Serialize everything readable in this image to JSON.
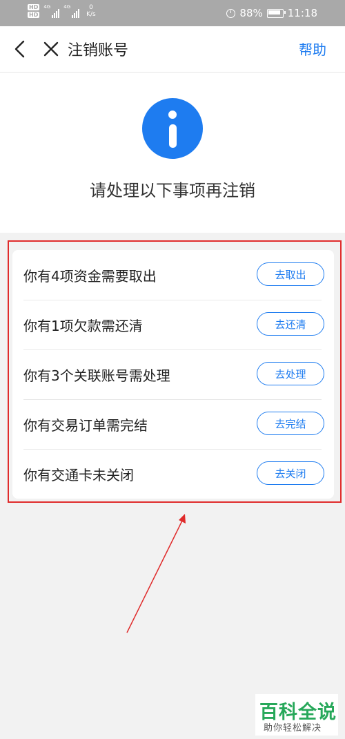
{
  "status_bar": {
    "hd_top": "HD",
    "hd_bottom": "HD",
    "net1": "4G",
    "net2": "4G",
    "speed_value": "0",
    "speed_unit": "K/s",
    "battery": "88%",
    "time": "11:18"
  },
  "header": {
    "title": "注销账号",
    "help": "帮助",
    "icons": [
      "back-arrow-icon",
      "close-icon"
    ]
  },
  "hero": {
    "icon": "info-icon",
    "accent_color": "#1e7cf0",
    "subtitle": "请处理以下事项再注销"
  },
  "items": [
    {
      "label": "你有4项资金需要取出",
      "action": "去取出"
    },
    {
      "label": "你有1项欠款需还清",
      "action": "去还清"
    },
    {
      "label": "你有3个关联账号需处理",
      "action": "去处理"
    },
    {
      "label": "你有交易订单需完结",
      "action": "去完结"
    },
    {
      "label": "你有交通卡未关闭",
      "action": "去关闭"
    }
  ],
  "annotation": {
    "highlight_color": "#e02b2b"
  },
  "watermark": {
    "main": "百科全说",
    "sub": "助你轻松解决"
  }
}
